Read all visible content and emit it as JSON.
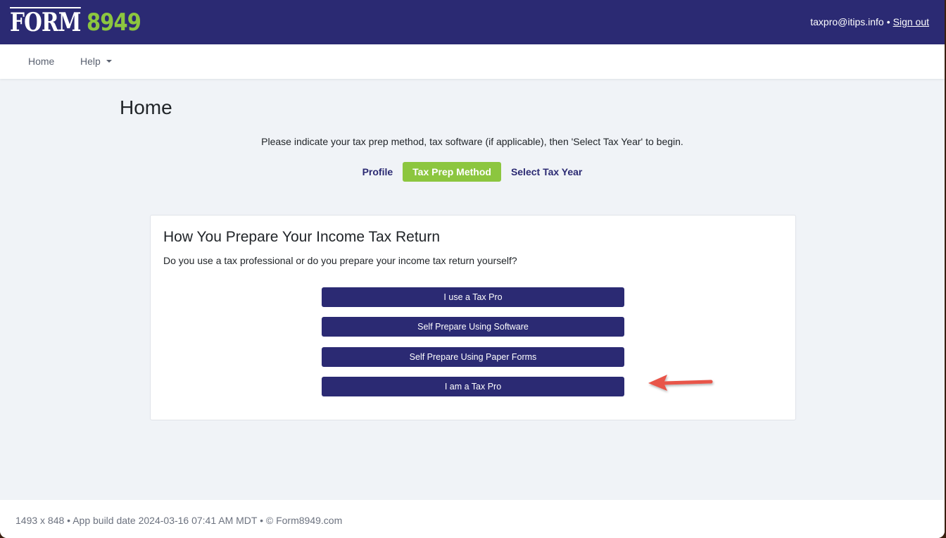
{
  "header": {
    "logo": {
      "word": "FORM",
      "number": "8949"
    },
    "user_email": "taxpro@itips.info",
    "separator": "•",
    "sign_out_label": "Sign out"
  },
  "nav": {
    "items": [
      {
        "label": "Home"
      },
      {
        "label": "Help",
        "has_dropdown": true
      }
    ]
  },
  "page": {
    "title": "Home",
    "instructions": "Please indicate your tax prep method, tax software (if applicable), then 'Select Tax Year' to begin.",
    "steps": [
      {
        "label": "Profile",
        "active": false
      },
      {
        "label": "Tax Prep Method",
        "active": true
      },
      {
        "label": "Select Tax Year",
        "active": false
      }
    ]
  },
  "card": {
    "title": "How You Prepare Your Income Tax Return",
    "question": "Do you use a tax professional or do you prepare your income tax return yourself?",
    "options": [
      {
        "label": "I use a Tax Pro"
      },
      {
        "label": "Self Prepare Using Software"
      },
      {
        "label": "Self Prepare Using Paper Forms"
      },
      {
        "label": "I am a Tax Pro",
        "highlighted_by_arrow": true
      }
    ]
  },
  "footer": {
    "text": "1493 x 848 • App build date 2024-03-16 07:41 AM MDT • © Form8949.com"
  },
  "colors": {
    "brand_navy": "#2b2a73",
    "brand_green": "#8cc63f",
    "page_bg": "#f0f3f7",
    "annotation_arrow": "#e8554a"
  }
}
